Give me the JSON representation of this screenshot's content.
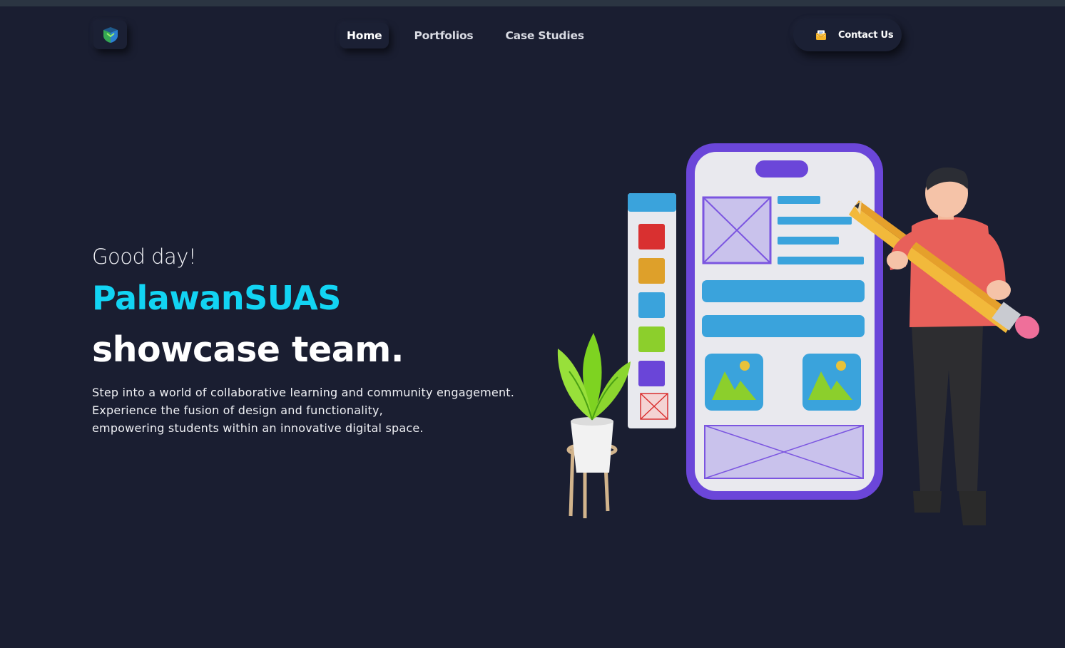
{
  "nav": {
    "items": [
      {
        "label": "Home",
        "active": true
      },
      {
        "label": "Portfolios",
        "active": false
      },
      {
        "label": "Case Studies",
        "active": false
      }
    ],
    "contact_label": "Contact Us",
    "logo_icon": "shield-logo-icon",
    "contact_icon": "mail-icon"
  },
  "hero": {
    "greeting": "Good day!",
    "brand": "PalawanSUAS",
    "headline": "showcase team.",
    "description": [
      "Step into a world of collaborative learning and community engagement.",
      "Experience the fusion of design and functionality,",
      "empowering students within an innovative digital space."
    ]
  },
  "colors": {
    "background": "#1a1e31",
    "brand_accent": "#12d4f3",
    "phone_frame": "#6b46d9",
    "shirt": "#e8605a"
  }
}
